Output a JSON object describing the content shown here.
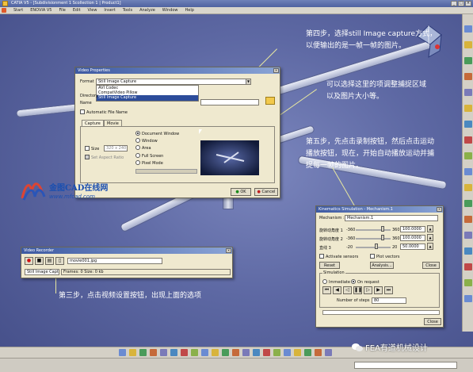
{
  "window": {
    "title": "CATIA V5 - [Subdivisionment 1 Scollection 1 | Product1]",
    "controls": [
      "_",
      "□",
      "×"
    ]
  },
  "menu": [
    "Start",
    "ENOVIA V5",
    "File",
    "Edit",
    "View",
    "Insert",
    "Tools",
    "Analyze",
    "Window",
    "Help"
  ],
  "annotations": {
    "step4": [
      "第四步，选择still Image capture方式，",
      "以便输出的是一帧一帧的图片。"
    ],
    "capture_area": [
      "可以选择这里的项调整捕捉区域",
      "以及图片大小等。"
    ],
    "step5": [
      "第五步，先点击录制按钮，然后点击运动",
      "播放按钮，现在，开始自动播放运动并捕",
      "捉每一帧的图片。"
    ],
    "step3": "第三步，点击视频设置按钮，出现上面的选项"
  },
  "video_properties": {
    "title": "Video Properties",
    "format_label": "Format",
    "format_value": "Still Image Capture",
    "format_options": [
      "AVI Codec",
      "CompatVideo Pillow",
      "Still Image Capture"
    ],
    "directory_label": "Directory",
    "name_label": "Name",
    "auto_file_name_label": "Automatic File Name",
    "tabs": [
      "Capture",
      "Movie"
    ],
    "capture_options": [
      "Document Window",
      "Window",
      "Area",
      "Full Screen",
      "Pixel Mode"
    ],
    "selected_capture": "Document Window",
    "size_label": "Size",
    "size_value": "320 x 240",
    "aspect_label": "Set Aspect Ratio",
    "ok": "OK",
    "cancel": "Cancel"
  },
  "video_recorder": {
    "title": "Video Recorder",
    "file_value": "movie001.jpg",
    "mode_value": "Still Image Capture",
    "frames_text": "Frames: 0  Size: 0  kb"
  },
  "kinematics": {
    "title": "Kinematics Simulation - Mechanism.1",
    "mechanism_label": "Mechanism :",
    "mechanism_value": "Mechanism.1",
    "commands": [
      {
        "label": "旋转动角度 1",
        "min": "-360",
        "max": "360",
        "value": "100.0000",
        "fraction": 0.77
      },
      {
        "label": "旋转动角度 2",
        "min": "-360",
        "max": "360",
        "value": "100.0000",
        "fraction": 0.77
      },
      {
        "label": "直线 3",
        "min": "-20",
        "max": "20",
        "value": "50.0000",
        "fraction": 0.6
      }
    ],
    "activate_sensors": "Activate sensors",
    "plot_vectors": "Plot vectors",
    "reset": "Reset",
    "analysis": "Analysis...",
    "close_top": "Close",
    "simulation_label": "Simulation",
    "immediate": "Immediate",
    "on_request": "On request",
    "number_of_steps_label": "Number of steps",
    "number_of_steps_value": "80",
    "close": "Close"
  },
  "watermark": {
    "line1": "金图CAD在线网",
    "line2": "www.mfcad.com"
  },
  "wechat_mark": "FEA有道机械设计"
}
